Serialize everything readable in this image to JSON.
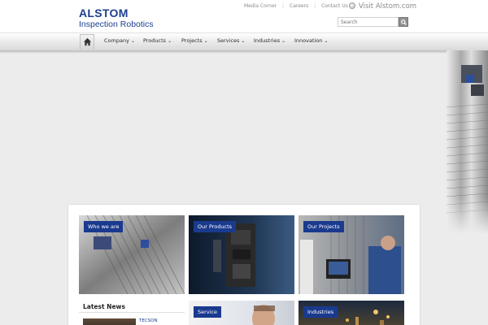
{
  "brand": {
    "name": "ALSTOM",
    "subtitle": "Inspection Robotics",
    "color": "#1d3f8f"
  },
  "top_links": [
    "Media Corner",
    "Careers",
    "Contact Us"
  ],
  "visit_link": "Visit Alstom.com",
  "search": {
    "placeholder": "Search"
  },
  "nav": {
    "home_icon": "home-icon",
    "items": [
      {
        "label": "Company"
      },
      {
        "label": "Products"
      },
      {
        "label": "Projects"
      },
      {
        "label": "Services"
      },
      {
        "label": "Industries"
      },
      {
        "label": "Innovation"
      }
    ]
  },
  "tiles": [
    {
      "label": "Who we are"
    },
    {
      "label": "Our Products"
    },
    {
      "label": "Our Projects"
    },
    {
      "label": "Service"
    },
    {
      "label": "Industries"
    }
  ],
  "news": {
    "title": "Latest News",
    "items": [
      {
        "label": "TECSON"
      }
    ]
  },
  "colors": {
    "badge": "#1a3a8e",
    "background": "#ececec"
  }
}
